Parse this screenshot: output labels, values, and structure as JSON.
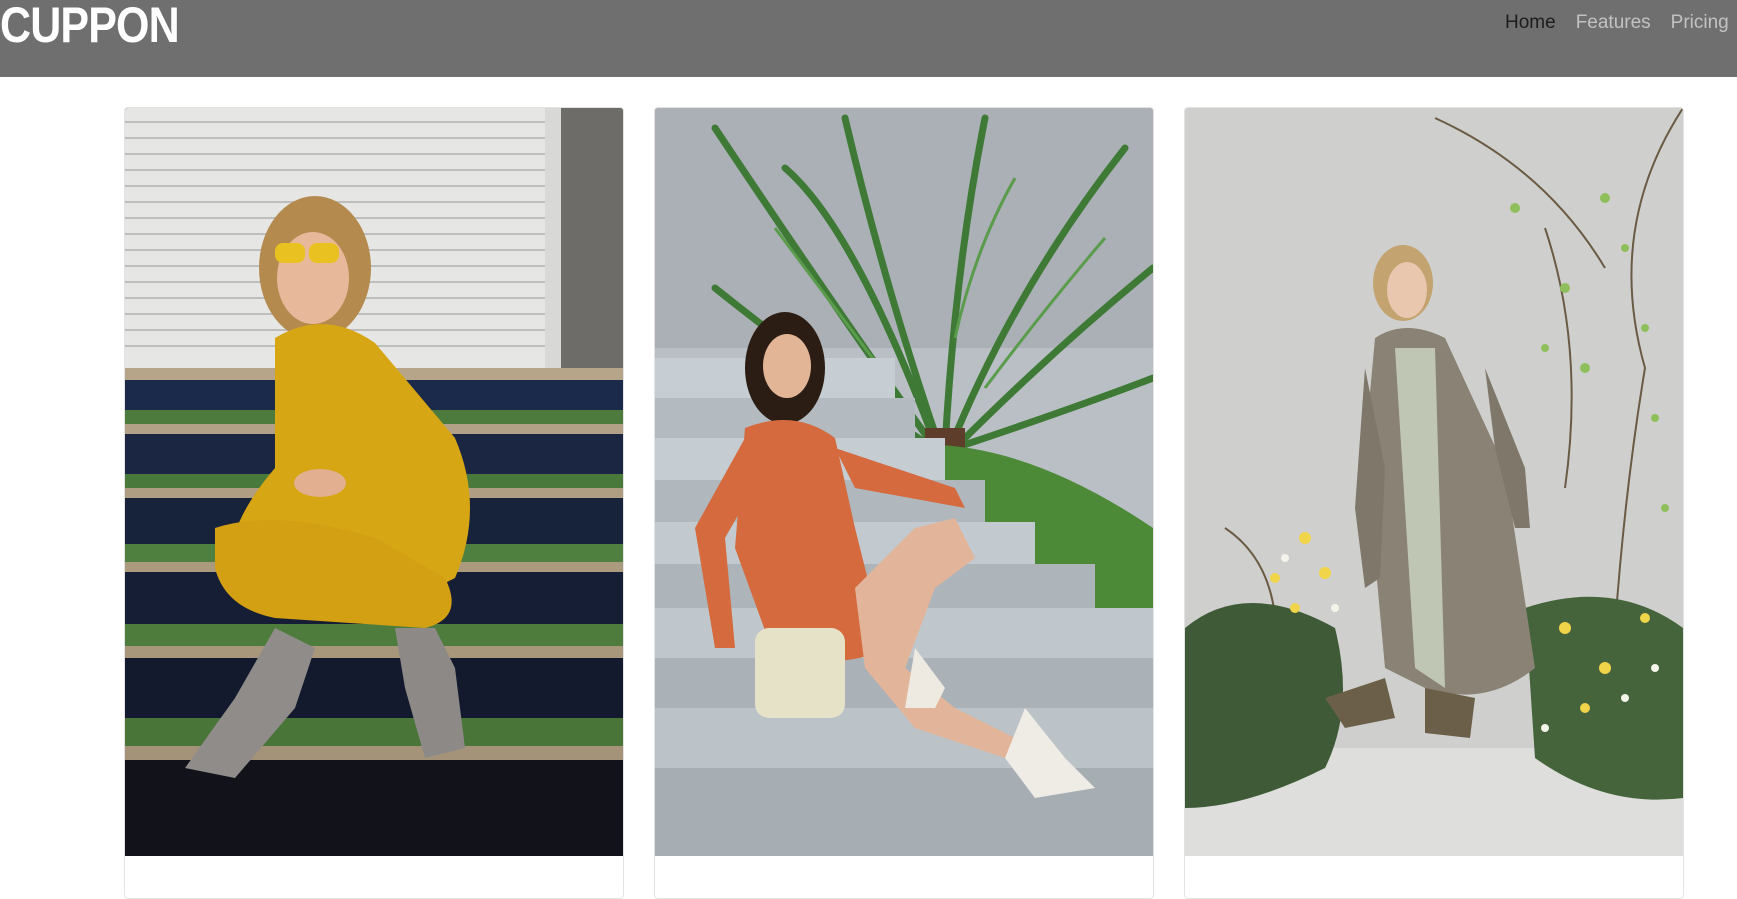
{
  "navbar": {
    "brand": "CUPPON",
    "links": [
      {
        "label": "Home",
        "active": true
      },
      {
        "label": "Features",
        "active": false
      },
      {
        "label": "Pricing",
        "active": false
      }
    ]
  },
  "colors": {
    "navbar_bg": "#6f6f6f",
    "link_active": "#1d1d1d",
    "link_inactive": "#c2c2c2"
  },
  "cards": [
    {
      "image": "woman-yellow-dress-on-stairs-photo"
    },
    {
      "image": "woman-orange-dress-by-palm-photo"
    },
    {
      "image": "woman-trench-coat-with-flowers-photo"
    }
  ]
}
